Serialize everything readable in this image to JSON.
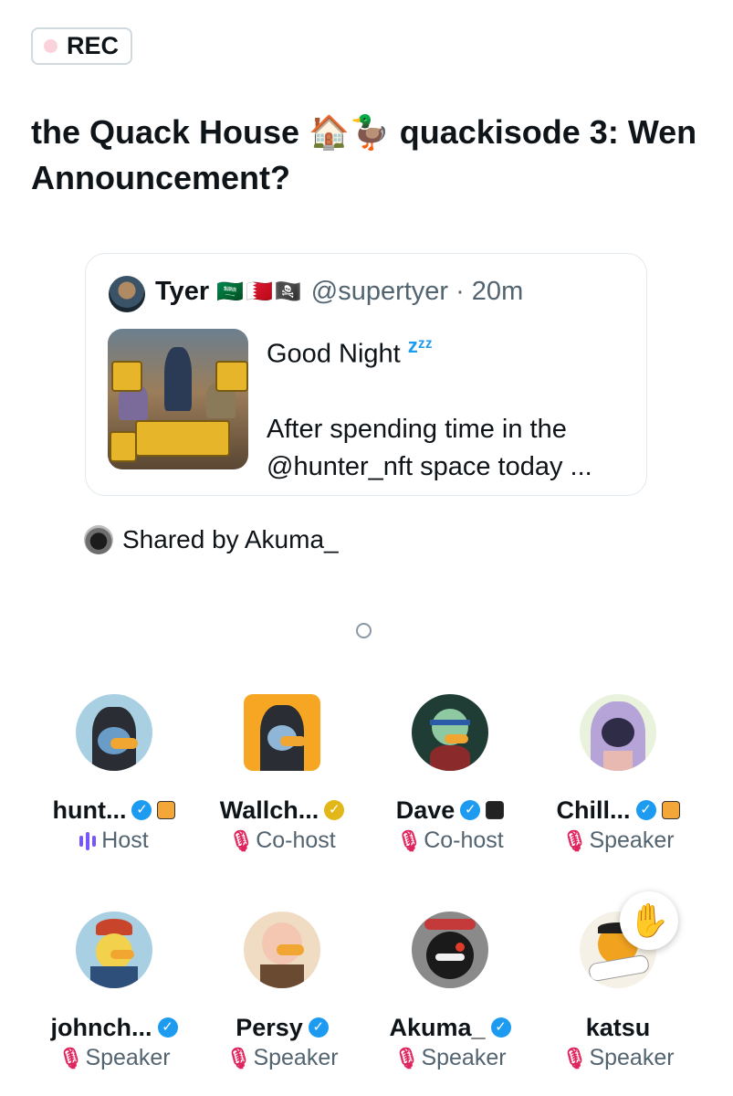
{
  "rec_label": "REC",
  "space_title": "the Quack House 🏠🦆 quackisode 3: Wen Announcement?",
  "tweet": {
    "author_name": "Tyer",
    "author_flags": "🇸🇦🇧🇭🏴‍☠️",
    "author_handle": "@supertyer",
    "time": "· 20m",
    "line1": "Good Night",
    "zz": "zᶻᶻ",
    "line2": "After spending time in the",
    "line3": "@hunter_nft space today ..."
  },
  "shared_by": "Shared by Akuma_",
  "participants": [
    {
      "name": "hunt...",
      "role": "Host",
      "verified": "blue",
      "affiliate": true
    },
    {
      "name": "Wallch...",
      "role": "Co-host",
      "verified": "gold",
      "affiliate": false
    },
    {
      "name": "Dave",
      "role": "Co-host",
      "verified": "blue",
      "affiliate": true
    },
    {
      "name": "Chill...",
      "role": "Speaker",
      "verified": "blue",
      "affiliate": true
    },
    {
      "name": "johnch...",
      "role": "Speaker",
      "verified": "blue",
      "affiliate": false
    },
    {
      "name": "Persy",
      "role": "Speaker",
      "verified": "blue",
      "affiliate": false
    },
    {
      "name": "Akuma_",
      "role": "Speaker",
      "verified": "blue",
      "affiliate": false
    },
    {
      "name": "katsu",
      "role": "Speaker",
      "verified": "none",
      "affiliate": false
    }
  ],
  "icons": {
    "verified": "checkmark-badge-icon",
    "mic_off": "mic-off-icon",
    "host": "audio-bars-icon",
    "raised_hand": "raised-hand-icon"
  },
  "colors": {
    "verified_blue": "#1d9bf0",
    "verified_gold": "#e2b719",
    "mic_off": "#e0245e",
    "host_accent": "#7856ff"
  }
}
